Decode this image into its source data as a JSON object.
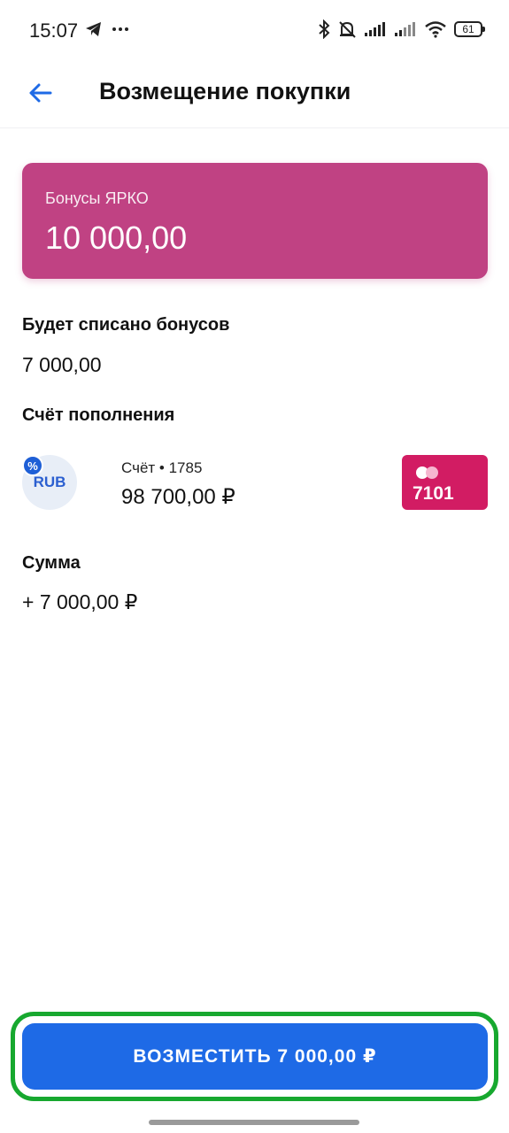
{
  "status_bar": {
    "time": "15:07",
    "battery": "61",
    "icons": [
      "telegram-icon",
      "more-icon",
      "bluetooth-icon",
      "bell-off-icon",
      "signal-icon",
      "signal-icon",
      "wifi-icon",
      "battery-icon"
    ]
  },
  "header": {
    "title": "Возмещение покупки",
    "back_icon": "arrow-left-icon"
  },
  "bonus_card": {
    "label": "Бонусы ЯРКО",
    "value": "10 000,00",
    "color": "#c04283"
  },
  "write_off": {
    "label": "Будет списано бонусов",
    "value": "7 000,00"
  },
  "account": {
    "label": "Счёт пополнения",
    "currency": "RUB",
    "badge": "%",
    "caption": "Счёт • 1785",
    "balance": "98 700,00 ₽",
    "card_number": "7101",
    "card_color": "#d21c63"
  },
  "amount": {
    "label": "Сумма",
    "value": "+ 7 000,00 ₽"
  },
  "action": {
    "button_label": "ВОЗМЕСТИТЬ 7 000,00 ₽",
    "button_color": "#1e6ae6",
    "highlight_color": "#17a82f"
  }
}
